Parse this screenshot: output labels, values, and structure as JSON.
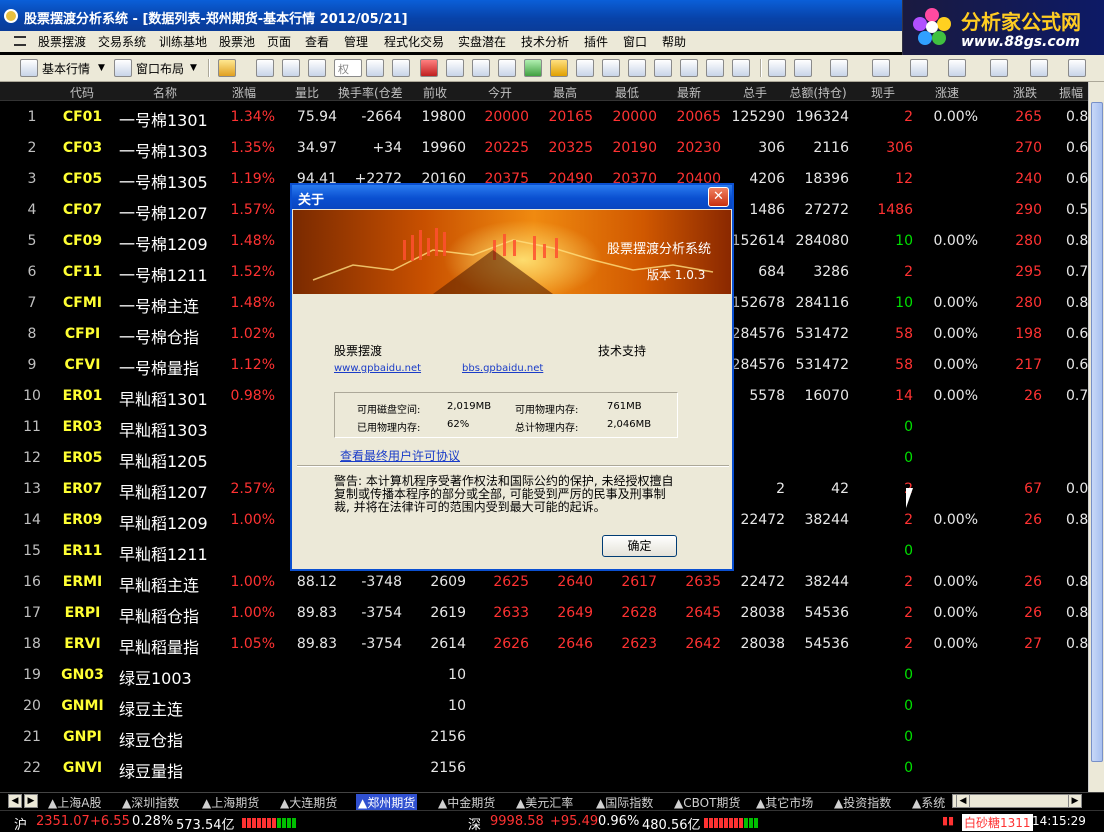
{
  "window": {
    "title": "股票摆渡分析系统 - [数据列表-郑州期货-基本行情 2012/05/21]"
  },
  "brand": {
    "name": "分析家公式网",
    "url": "www.88gs.com"
  },
  "menu": [
    "股票摆渡",
    "交易系统",
    "训练基地",
    "股票池",
    "页面",
    "查看",
    "管理",
    "程式化交易",
    "实盘潜在",
    "技术分析",
    "插件",
    "窗口",
    "帮助"
  ],
  "toolbar": {
    "quote_label": "基本行情",
    "layout_label": "窗口布局",
    "rights_label": "权"
  },
  "columns": [
    "代码",
    "名称",
    "涨幅",
    "量比",
    "换手率(仓差",
    "前收",
    "今开",
    "最高",
    "最低",
    "最新",
    "总手",
    "总额(持仓)",
    "现手",
    "涨速",
    "涨跌",
    "振幅"
  ],
  "rows": [
    {
      "idx": "1",
      "code": "CF01",
      "name": "一号棉1301",
      "chg": "1.34%",
      "vr": "75.94",
      "tr": "-2664",
      "prev": "19800",
      "open": "20000",
      "high": "20165",
      "low": "20000",
      "last": "20065",
      "vol": "125290",
      "amt": "196324",
      "cur": "2",
      "spd": "0.00%",
      "diff": "265",
      "amp": "0.8"
    },
    {
      "idx": "2",
      "code": "CF03",
      "name": "一号棉1303",
      "chg": "1.35%",
      "vr": "34.97",
      "tr": "+34",
      "prev": "19960",
      "open": "20225",
      "high": "20325",
      "low": "20190",
      "last": "20230",
      "vol": "306",
      "amt": "2116",
      "cur": "306",
      "spd": "",
      "diff": "270",
      "amp": "0.6"
    },
    {
      "idx": "3",
      "code": "CF05",
      "name": "一号棉1305",
      "chg": "1.19%",
      "vr": "94.41",
      "tr": "+2272",
      "prev": "20160",
      "open": "20375",
      "high": "20490",
      "low": "20370",
      "last": "20400",
      "vol": "4206",
      "amt": "18396",
      "cur": "12",
      "spd": "",
      "diff": "240",
      "amp": "0.6"
    },
    {
      "idx": "4",
      "code": "CF07",
      "name": "一号棉1207",
      "chg": "1.57%",
      "vr": "",
      "tr": "",
      "prev": "",
      "open": "",
      "high": "",
      "low": "",
      "last": "",
      "vol": "1486",
      "amt": "27272",
      "cur": "1486",
      "spd": "",
      "diff": "290",
      "amp": "0.5"
    },
    {
      "idx": "5",
      "code": "CF09",
      "name": "一号棉1209",
      "chg": "1.48%",
      "vr": "",
      "tr": "",
      "prev": "",
      "open": "",
      "high": "",
      "low": "",
      "last": "",
      "vol": "152614",
      "amt": "284080",
      "cur": "10",
      "spd": "0.00%",
      "diff": "280",
      "amp": "0.8"
    },
    {
      "idx": "6",
      "code": "CF11",
      "name": "一号棉1211",
      "chg": "1.52%",
      "vr": "",
      "tr": "",
      "prev": "",
      "open": "",
      "high": "",
      "low": "",
      "last": "",
      "vol": "684",
      "amt": "3286",
      "cur": "2",
      "spd": "",
      "diff": "295",
      "amp": "0.7"
    },
    {
      "idx": "7",
      "code": "CFMI",
      "name": "一号棉主连",
      "chg": "1.48%",
      "vr": "",
      "tr": "",
      "prev": "",
      "open": "",
      "high": "",
      "low": "",
      "last": "",
      "vol": "152678",
      "amt": "284116",
      "cur": "10",
      "spd": "0.00%",
      "diff": "280",
      "amp": "0.8"
    },
    {
      "idx": "8",
      "code": "CFPI",
      "name": "一号棉仓指",
      "chg": "1.02%",
      "vr": "",
      "tr": "",
      "prev": "",
      "open": "",
      "high": "",
      "low": "",
      "last": "",
      "vol": "284576",
      "amt": "531472",
      "cur": "58",
      "spd": "0.00%",
      "diff": "198",
      "amp": "0.6"
    },
    {
      "idx": "9",
      "code": "CFVI",
      "name": "一号棉量指",
      "chg": "1.12%",
      "vr": "",
      "tr": "",
      "prev": "",
      "open": "",
      "high": "",
      "low": "",
      "last": "",
      "vol": "284576",
      "amt": "531472",
      "cur": "58",
      "spd": "0.00%",
      "diff": "217",
      "amp": "0.6"
    },
    {
      "idx": "10",
      "code": "ER01",
      "name": "早籼稻1301",
      "chg": "0.98%",
      "vr": "",
      "tr": "",
      "prev": "",
      "open": "",
      "high": "",
      "low": "",
      "last": "",
      "vol": "5578",
      "amt": "16070",
      "cur": "14",
      "spd": "0.00%",
      "diff": "26",
      "amp": "0.7"
    },
    {
      "idx": "11",
      "code": "ER03",
      "name": "早籼稻1303",
      "chg": "",
      "vr": "",
      "tr": "",
      "prev": "",
      "open": "",
      "high": "",
      "low": "",
      "last": "",
      "vol": "",
      "amt": "",
      "cur": "0",
      "spd": "",
      "diff": "",
      "amp": ""
    },
    {
      "idx": "12",
      "code": "ER05",
      "name": "早籼稻1205",
      "chg": "",
      "vr": "",
      "tr": "",
      "prev": "",
      "open": "",
      "high": "",
      "low": "",
      "last": "",
      "vol": "",
      "amt": "",
      "cur": "0",
      "spd": "",
      "diff": "",
      "amp": ""
    },
    {
      "idx": "13",
      "code": "ER07",
      "name": "早籼稻1207",
      "chg": "2.57%",
      "vr": "",
      "tr": "",
      "prev": "",
      "open": "",
      "high": "",
      "low": "",
      "last": "",
      "vol": "2",
      "amt": "42",
      "cur": "2",
      "spd": "",
      "diff": "67",
      "amp": "0.0"
    },
    {
      "idx": "14",
      "code": "ER09",
      "name": "早籼稻1209",
      "chg": "1.00%",
      "vr": "",
      "tr": "",
      "prev": "",
      "open": "",
      "high": "",
      "low": "",
      "last": "",
      "vol": "22472",
      "amt": "38244",
      "cur": "2",
      "spd": "0.00%",
      "diff": "26",
      "amp": "0.8"
    },
    {
      "idx": "15",
      "code": "ER11",
      "name": "早籼稻1211",
      "chg": "",
      "vr": "",
      "tr": "",
      "prev": "",
      "open": "",
      "high": "",
      "low": "",
      "last": "",
      "vol": "",
      "amt": "",
      "cur": "0",
      "spd": "",
      "diff": "",
      "amp": ""
    },
    {
      "idx": "16",
      "code": "ERMI",
      "name": "早籼稻主连",
      "chg": "1.00%",
      "vr": "88.12",
      "tr": "-3748",
      "prev": "2609",
      "open": "2625",
      "high": "2640",
      "low": "2617",
      "last": "2635",
      "vol": "22472",
      "amt": "38244",
      "cur": "2",
      "spd": "0.00%",
      "diff": "26",
      "amp": "0.8"
    },
    {
      "idx": "17",
      "code": "ERPI",
      "name": "早籼稻仓指",
      "chg": "1.00%",
      "vr": "89.83",
      "tr": "-3754",
      "prev": "2619",
      "open": "2633",
      "high": "2649",
      "low": "2628",
      "last": "2645",
      "vol": "28038",
      "amt": "54536",
      "cur": "2",
      "spd": "0.00%",
      "diff": "26",
      "amp": "0.8"
    },
    {
      "idx": "18",
      "code": "ERVI",
      "name": "早籼稻量指",
      "chg": "1.05%",
      "vr": "89.83",
      "tr": "-3754",
      "prev": "2614",
      "open": "2626",
      "high": "2646",
      "low": "2623",
      "last": "2642",
      "vol": "28038",
      "amt": "54536",
      "cur": "2",
      "spd": "0.00%",
      "diff": "27",
      "amp": "0.8"
    },
    {
      "idx": "19",
      "code": "GN03",
      "name": "绿豆1003",
      "chg": "",
      "vr": "",
      "tr": "",
      "prev": "10",
      "open": "",
      "high": "",
      "low": "",
      "last": "",
      "vol": "",
      "amt": "",
      "cur": "0",
      "spd": "",
      "diff": "",
      "amp": ""
    },
    {
      "idx": "20",
      "code": "GNMI",
      "name": "绿豆主连",
      "chg": "",
      "vr": "",
      "tr": "",
      "prev": "10",
      "open": "",
      "high": "",
      "low": "",
      "last": "",
      "vol": "",
      "amt": "",
      "cur": "0",
      "spd": "",
      "diff": "",
      "amp": ""
    },
    {
      "idx": "21",
      "code": "GNPI",
      "name": "绿豆仓指",
      "chg": "",
      "vr": "",
      "tr": "",
      "prev": "2156",
      "open": "",
      "high": "",
      "low": "",
      "last": "",
      "vol": "",
      "amt": "",
      "cur": "0",
      "spd": "",
      "diff": "",
      "amp": ""
    },
    {
      "idx": "22",
      "code": "GNVI",
      "name": "绿豆量指",
      "chg": "",
      "vr": "",
      "tr": "",
      "prev": "2156",
      "open": "",
      "high": "",
      "low": "",
      "last": "",
      "vol": "",
      "amt": "",
      "cur": "0",
      "spd": "",
      "diff": "",
      "amp": ""
    }
  ],
  "tabs": [
    "▲上海A股",
    "▲深圳指数",
    "▲上海期货",
    "▲大连期货",
    "▲郑州期货",
    "▲中金期货",
    "▲美元汇率",
    "▲国际指数",
    "▲CBOT期货",
    "▲其它市场",
    "▲投资指数",
    "▲系统"
  ],
  "active_tab": 4,
  "status": {
    "sh_label": "沪",
    "sh_value": "2351.07",
    "sh_change": "+6.55",
    "sh_pct": "0.28%",
    "sh_amount": "573.54亿",
    "sz_label": "深",
    "sz_value": "9998.58",
    "sz_change": "+95.49",
    "sz_pct": "0.96%",
    "sz_amount": "480.56亿",
    "ticker": "白砂糖1311",
    "time": "14:15:29"
  },
  "dialog": {
    "title": "关于",
    "product": "股票摆渡分析系统",
    "version": "版本 1.0.3",
    "company": "股票摆渡",
    "support": "技术支持",
    "site_link": "www.gpbaidu.net",
    "bbs_link": "bbs.gpbaidu.net",
    "disk_label": "可用磁盘空间:",
    "disk_value": "2,019MB",
    "phys_free_label": "可用物理内存:",
    "phys_free_value": "761MB",
    "mem_used_label": "已用物理内存:",
    "mem_used_value": "62%",
    "phys_total_label": "总计物理内存:",
    "phys_total_value": "2,046MB",
    "license_link": "查看最终用户许可协议",
    "warning": "警告: 本计算机程序受著作权法和国际公约的保护, 未经授权擅自复制或传播本程序的部分或全部, 可能受到严厉的民事及刑事制裁, 并将在法律许可的范围内受到最大可能的起诉。",
    "ok_label": "确定"
  },
  "colors": {
    "up": "#ff3232",
    "zero": "#00e000",
    "code": "#ffff33",
    "active_tab": "#3050d0"
  }
}
